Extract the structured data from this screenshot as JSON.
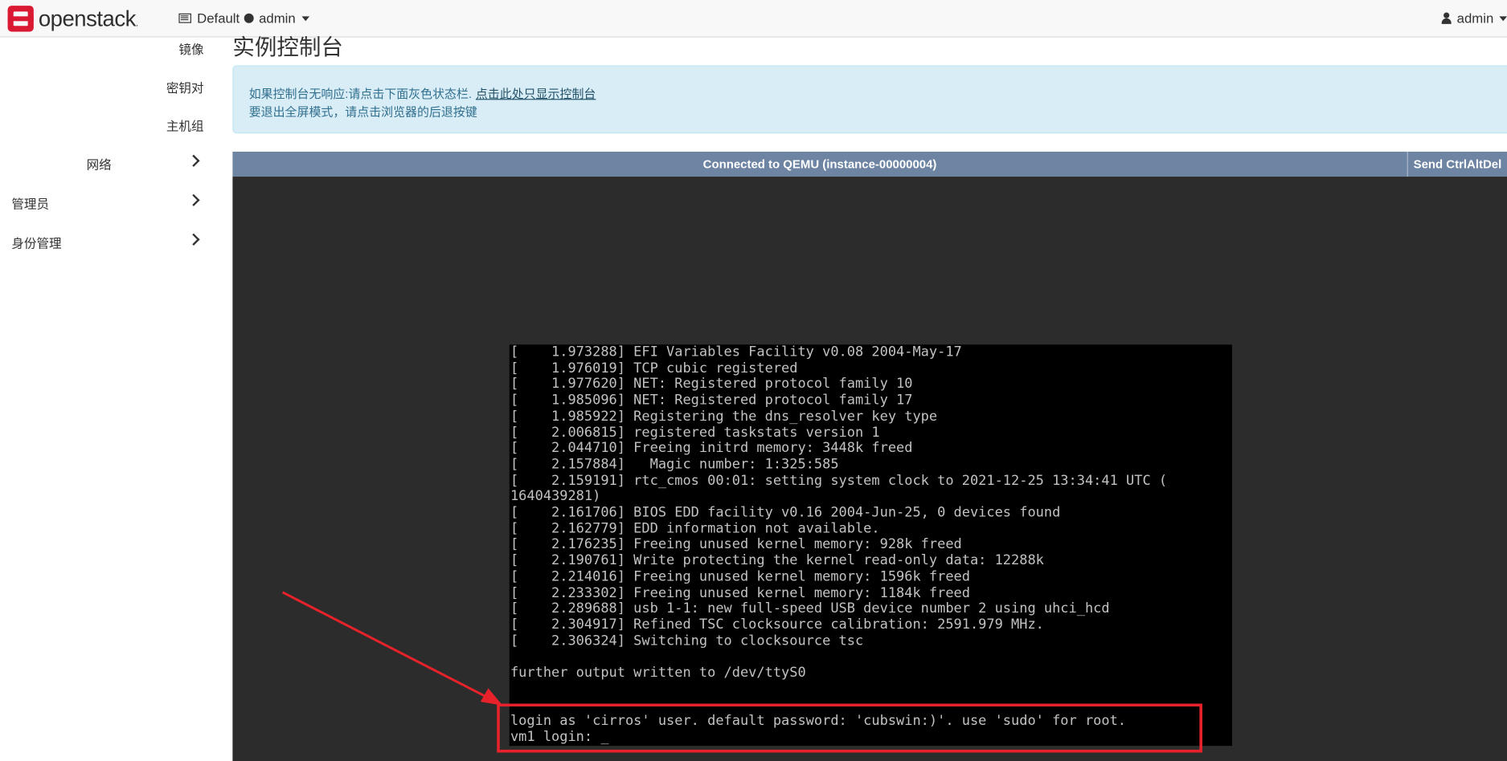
{
  "navbar": {
    "brand": "openstack",
    "brand_mark": ".",
    "project_domain": "Default",
    "project_name": "admin",
    "user": "admin"
  },
  "sidebar": {
    "sub_items": [
      "镜像",
      "密钥对",
      "主机组"
    ],
    "network": "网络",
    "admin": "管理员",
    "identity": "身份管理"
  },
  "page": {
    "title": "实例控制台",
    "alert_line1": "如果控制台无响应:请点击下面灰色状态栏.",
    "alert_link": "点击此处只显示控制台",
    "alert_line2": "要退出全屏模式，请点击浏览器的后退按键"
  },
  "console": {
    "status": "Connected to QEMU (instance-00000004)",
    "ctrl_alt_del": "Send CtrlAltDel",
    "lines": [
      "[    1.973288] EFI Variables Facility v0.08 2004-May-17",
      "[    1.976019] TCP cubic registered",
      "[    1.977620] NET: Registered protocol family 10",
      "[    1.985096] NET: Registered protocol family 17",
      "[    1.985922] Registering the dns_resolver key type",
      "[    2.006815] registered taskstats version 1",
      "[    2.044710] Freeing initrd memory: 3448k freed",
      "[    2.157884]   Magic number: 1:325:585",
      "[    2.159191] rtc_cmos 00:01: setting system clock to 2021-12-25 13:34:41 UTC (",
      "1640439281)",
      "[    2.161706] BIOS EDD facility v0.16 2004-Jun-25, 0 devices found",
      "[    2.162779] EDD information not available.",
      "[    2.176235] Freeing unused kernel memory: 928k freed",
      "[    2.190761] Write protecting the kernel read-only data: 12288k",
      "[    2.214016] Freeing unused kernel memory: 1596k freed",
      "[    2.233302] Freeing unused kernel memory: 1184k freed",
      "[    2.289688] usb 1-1: new full-speed USB device number 2 using uhci_hcd",
      "[    2.304917] Refined TSC clocksource calibration: 2591.979 MHz.",
      "[    2.306324] Switching to clocksource tsc",
      "",
      "further output written to /dev/ttyS0",
      "",
      "",
      "login as 'cirros' user. default password: 'cubswin:)'. use 'sudo' for root.",
      "vm1 login: _"
    ]
  },
  "colors": {
    "alert_bg": "#d9edf7",
    "console_bar": "#6e84a3",
    "annotation": "#e8222a",
    "brand_red": "#da1a32"
  }
}
